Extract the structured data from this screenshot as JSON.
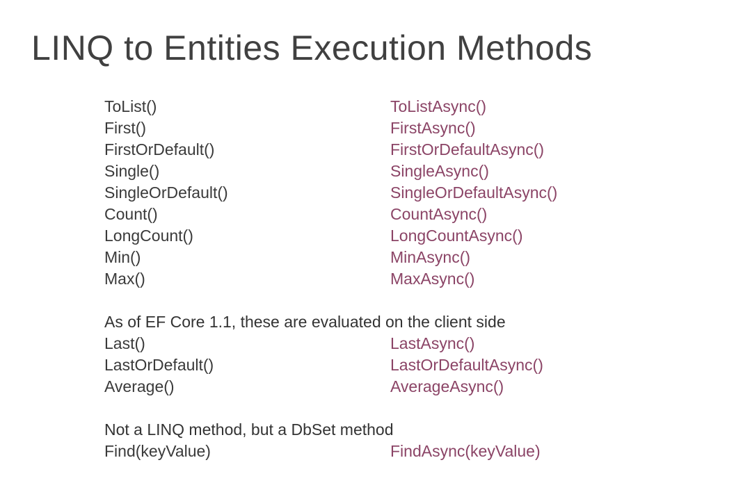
{
  "slide": {
    "title": "LINQ to Entities Execution Methods"
  },
  "section1": {
    "rows": [
      {
        "sync": "ToList()",
        "async": "ToListAsync()"
      },
      {
        "sync": "First()",
        "async": "FirstAsync()"
      },
      {
        "sync": "FirstOrDefault()",
        "async": "FirstOrDefaultAsync()"
      },
      {
        "sync": "Single()",
        "async": "SingleAsync()"
      },
      {
        "sync": "SingleOrDefault()",
        "async": "SingleOrDefaultAsync()"
      },
      {
        "sync": "Count()",
        "async": "CountAsync()"
      },
      {
        "sync": "LongCount()",
        "async": "LongCountAsync()"
      },
      {
        "sync": "Min()",
        "async": "MinAsync()"
      },
      {
        "sync": "Max()",
        "async": "MaxAsync()"
      }
    ]
  },
  "section2": {
    "heading": "As of EF Core 1.1, these are evaluated on the client side",
    "rows": [
      {
        "sync": "Last()",
        "async": "LastAsync()"
      },
      {
        "sync": "LastOrDefault()",
        "async": "LastOrDefaultAsync()"
      },
      {
        "sync": "Average()",
        "async": "AverageAsync()"
      }
    ]
  },
  "section3": {
    "heading": "Not a LINQ method, but a DbSet method",
    "rows": [
      {
        "sync": "Find(keyValue)",
        "async": "FindAsync(keyValue)"
      }
    ]
  },
  "colors": {
    "text": "#3a3a3a",
    "async_accent": "#8b4466",
    "title": "#404040"
  }
}
